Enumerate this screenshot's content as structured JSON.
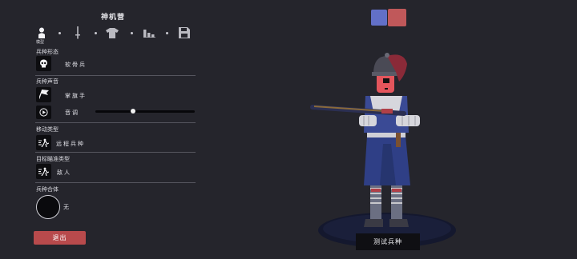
{
  "panel": {
    "title": "神机营",
    "tabs": [
      {
        "icon": "person-icon",
        "label": "模型"
      },
      {
        "icon": "sword-icon",
        "label": ""
      },
      {
        "icon": "shirt-icon",
        "label": ""
      },
      {
        "icon": "stats-icon",
        "label": ""
      },
      {
        "icon": "save-icon",
        "label": ""
      }
    ],
    "appearance": {
      "label": "兵种形态",
      "value": "软骨兵",
      "icon": "skull-icon"
    },
    "voice": {
      "label": "兵种声音",
      "value": "掌旗手",
      "icon": "flag-icon",
      "pitch_label": "音调",
      "pitch_icon": "play-icon",
      "pitch_level": 0.38
    },
    "movement": {
      "label": "移动类型",
      "value": "远程兵种",
      "icon": "movement-icon"
    },
    "targeting": {
      "label": "目标瞄准类型",
      "value": "敌人",
      "icon": "target-icon"
    },
    "combine": {
      "label": "兵种合体",
      "value": "无"
    },
    "exit_label": "退出"
  },
  "colors": {
    "team_blue": "#6270c8",
    "team_red": "#c0585a",
    "exit": "#b84a4c",
    "background": "#25252c"
  },
  "test_button_label": "测试兵种"
}
